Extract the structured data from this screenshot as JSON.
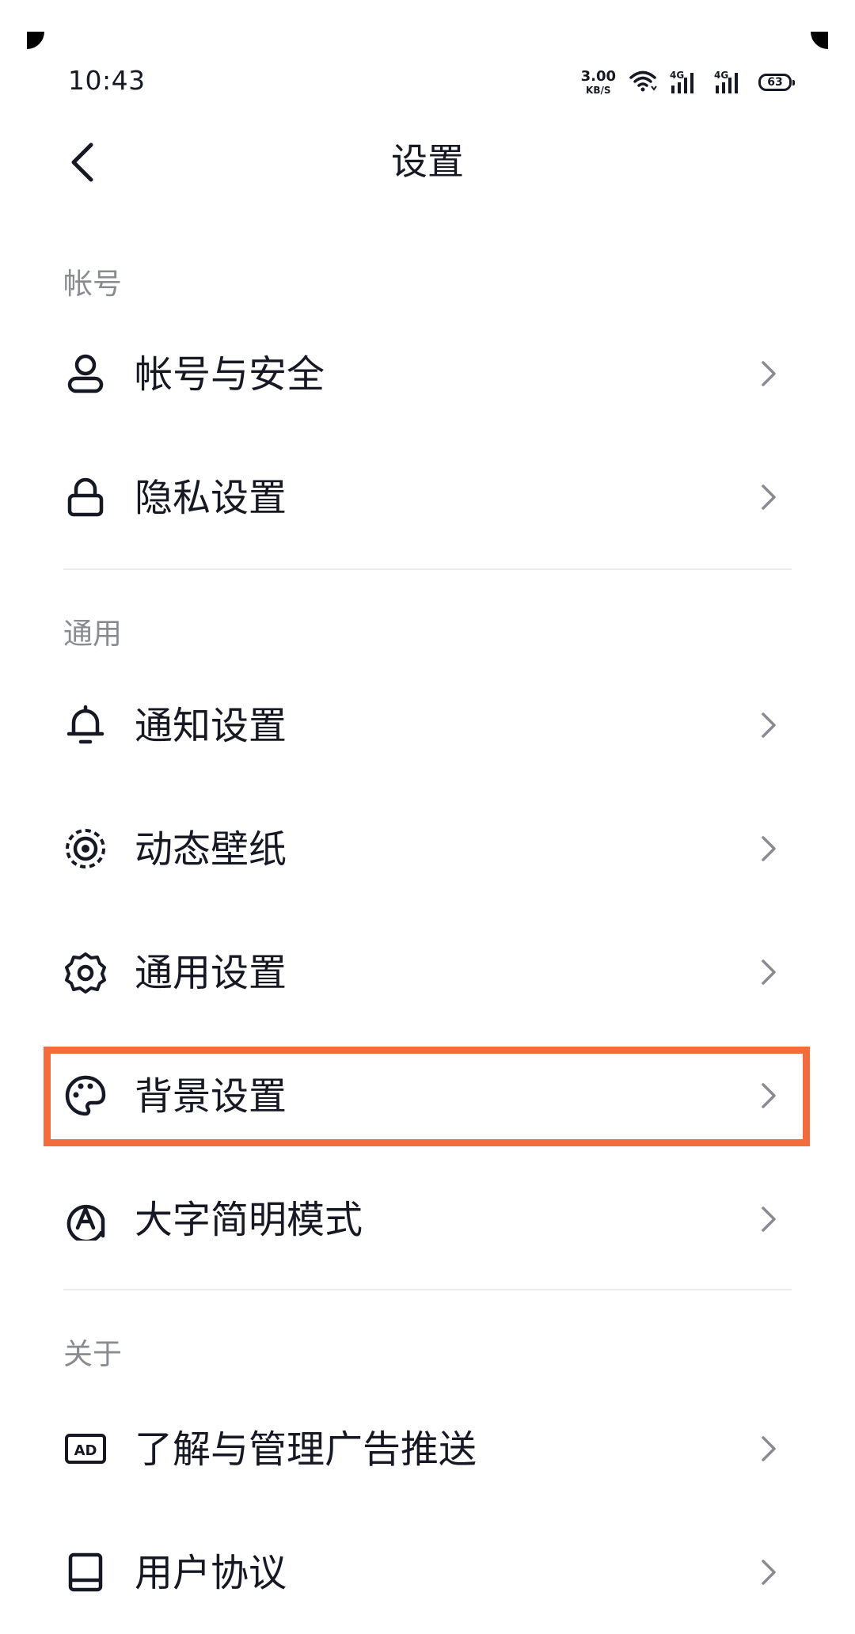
{
  "status_bar": {
    "time": "10:43",
    "net_speed_value": "3.00",
    "net_speed_unit": "KB/S",
    "signal_1_label": "4G",
    "signal_2_label": "4G",
    "battery": "63"
  },
  "nav": {
    "title": "设置"
  },
  "sections": {
    "account": {
      "header": "帐号",
      "items": [
        {
          "label": "帐号与安全",
          "icon": "user-icon"
        },
        {
          "label": "隐私设置",
          "icon": "lock-icon"
        }
      ]
    },
    "general": {
      "header": "通用",
      "items": [
        {
          "label": "通知设置",
          "icon": "bell-icon"
        },
        {
          "label": "动态壁纸",
          "icon": "live-wallpaper-icon"
        },
        {
          "label": "通用设置",
          "icon": "gear-icon"
        },
        {
          "label": "背景设置",
          "icon": "palette-icon"
        },
        {
          "label": "大字简明模式",
          "icon": "large-font-icon"
        }
      ]
    },
    "about": {
      "header": "关于",
      "items": [
        {
          "label": "了解与管理广告推送",
          "icon": "ad-icon"
        },
        {
          "label": "用户协议",
          "icon": "book-icon"
        }
      ]
    }
  },
  "colors": {
    "text": "#161823",
    "secondary": "#8a8b91",
    "highlight": "#f36c3d",
    "divider": "#ececee"
  }
}
